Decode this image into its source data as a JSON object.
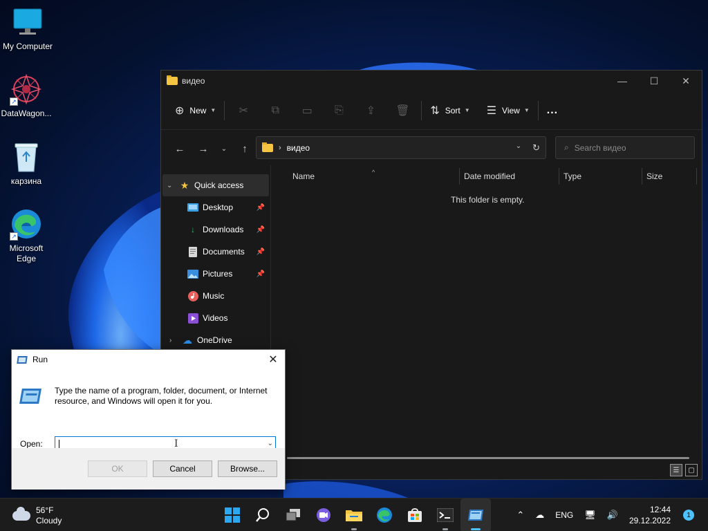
{
  "desktop": {
    "icons": [
      {
        "label": "My Computer"
      },
      {
        "label": "DataWagon..."
      },
      {
        "label": "карзина"
      },
      {
        "label": "Microsoft Edge"
      }
    ]
  },
  "explorer": {
    "title": "видео",
    "toolbar": {
      "new_label": "New",
      "sort_label": "Sort",
      "view_label": "View",
      "more_label": "..."
    },
    "address": {
      "path": "видео"
    },
    "search": {
      "placeholder": "Search видео"
    },
    "sidebar": {
      "quick_access": "Quick access",
      "items": [
        {
          "label": "Desktop",
          "pinned": true
        },
        {
          "label": "Downloads",
          "pinned": true
        },
        {
          "label": "Documents",
          "pinned": true
        },
        {
          "label": "Pictures",
          "pinned": true
        },
        {
          "label": "Music",
          "pinned": false
        },
        {
          "label": "Videos",
          "pinned": false
        }
      ],
      "onedrive": "OneDrive"
    },
    "columns": [
      "Name",
      "Date modified",
      "Type",
      "Size"
    ],
    "empty_message": "This folder is empty."
  },
  "run_dialog": {
    "title": "Run",
    "description": "Type the name of a program, folder, document, or Internet resource, and Windows will open it for you.",
    "open_label": "Open:",
    "input_value": "",
    "ok_label": "OK",
    "cancel_label": "Cancel",
    "browse_label": "Browse..."
  },
  "taskbar": {
    "weather": {
      "temp": "56°F",
      "condition": "Cloudy"
    },
    "language": "ENG",
    "time": "12:44",
    "date": "29.12.2022",
    "notifications": "1"
  },
  "colors": {
    "accent": "#4cc2ff",
    "folder": "#f4c542",
    "explorer_bg": "#191919",
    "taskbar_bg": "#1c1c1c"
  }
}
